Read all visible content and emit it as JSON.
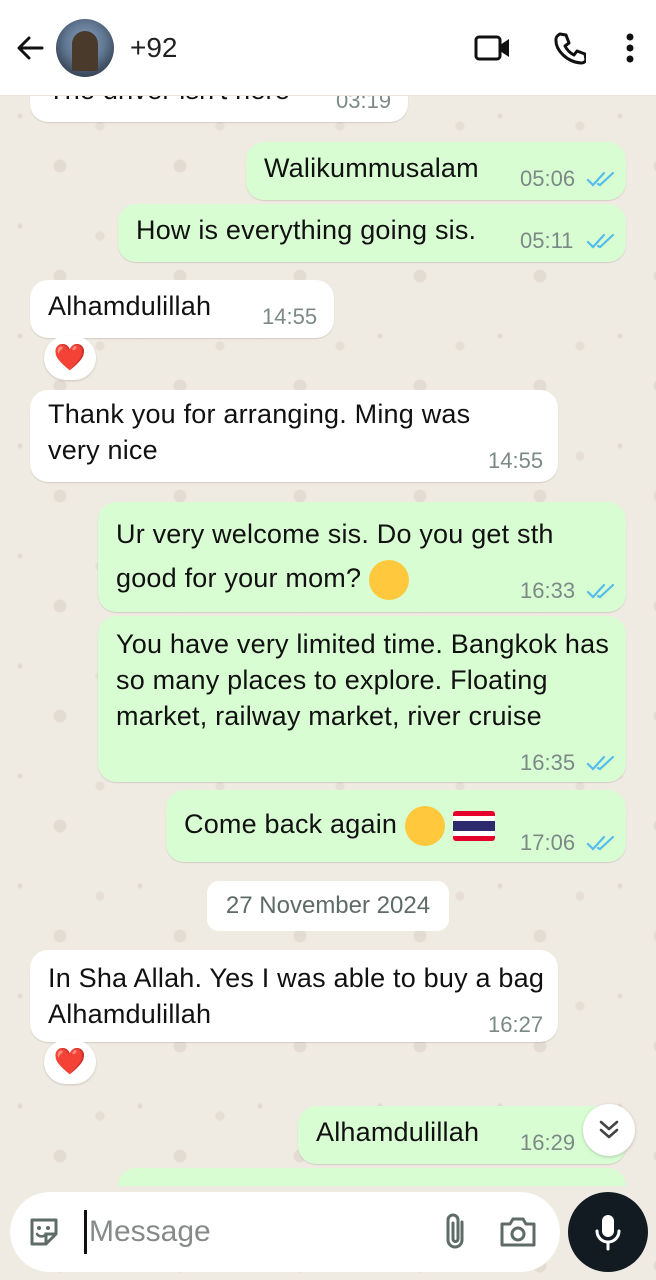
{
  "header": {
    "contact_name": "+92",
    "icons": [
      "back-arrow-icon",
      "video-call-icon",
      "voice-call-icon",
      "more-options-icon"
    ]
  },
  "messages": [
    {
      "dir": "in",
      "text": "The driver isn't here",
      "time": "03:19"
    },
    {
      "dir": "out",
      "text": "Walikummusalam",
      "time": "05:06",
      "status": "read"
    },
    {
      "dir": "out",
      "text": "How is everything going sis.",
      "time": "05:11",
      "status": "read"
    },
    {
      "dir": "in",
      "text": "Alhamdulillah",
      "time": "14:55",
      "reaction": "❤️"
    },
    {
      "dir": "in",
      "text": "Thank you for arranging. Ming was very nice",
      "time": "14:55"
    },
    {
      "dir": "out",
      "text": "Ur very welcome sis. Do you get sth good for your mom?",
      "time": "16:33",
      "status": "read"
    },
    {
      "dir": "out",
      "text": "You have very limited time. Bangkok has so many places to explore. Floating market, railway market, river cruise",
      "time": "16:35",
      "status": "read"
    },
    {
      "dir": "out",
      "text": "Come back again",
      "time": "17:06",
      "status": "read"
    },
    {
      "dir": "in",
      "text": "In Sha Allah. Yes I was able to buy a bag Alhamdulillah",
      "time": "16:27",
      "reaction": "❤️"
    },
    {
      "dir": "out",
      "text": "Alhamdulillah",
      "time": "16:29",
      "status": "read"
    }
  ],
  "date_divider": "27 November 2024",
  "composer": {
    "placeholder": "Message"
  },
  "colors": {
    "outgoing_bubble": "#d9fdd3",
    "incoming_bubble": "#ffffff",
    "read_ticks": "#53bdeb",
    "wallpaper": "#efeae2",
    "mic_button": "#111b21"
  }
}
